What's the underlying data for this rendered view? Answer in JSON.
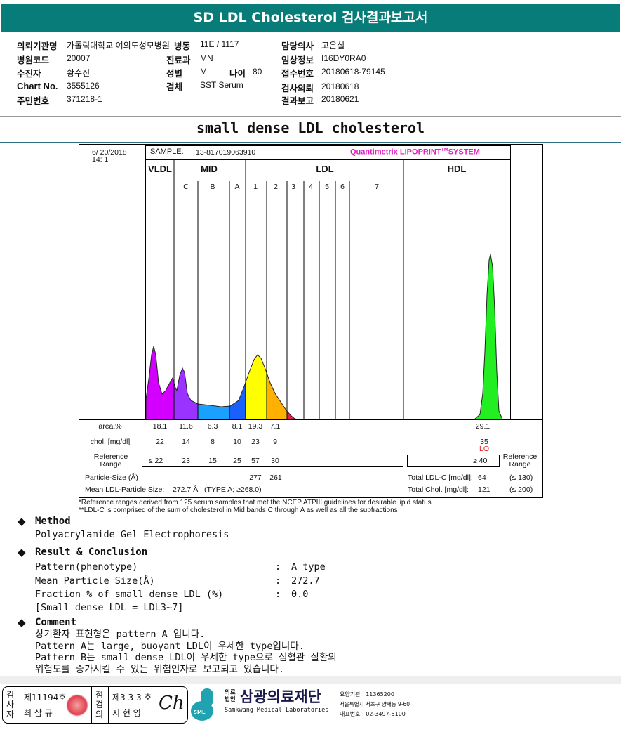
{
  "title": "SD LDL Cholesterol 검사결과보고서",
  "info": {
    "hospital_label": "의뢰기관명",
    "hospital": "가톨릭대학교 여의도성모병원",
    "ward_label": "병동",
    "ward": "11E / 1117",
    "doctor_label": "담당의사",
    "doctor": "고은실",
    "code_label": "병원코드",
    "code": "20007",
    "dept_label": "진료과",
    "dept": "MN",
    "clinical_label": "임상정보",
    "clinical": "I16DY0RA0",
    "patient_label": "수진자",
    "patient": "황수진",
    "sex_label": "성별",
    "sex": "M",
    "age_label": "나이",
    "age": "80",
    "receipt_label": "접수번호",
    "receipt": "20180618-79145",
    "chart_label": "Chart No.",
    "chart": "3555126",
    "specimen_label": "검체",
    "specimen": "SST Serum",
    "request_label": "검사의뢰",
    "request": "20180618",
    "id_label": "주민번호",
    "id": "371218-1",
    "report_label": "결과보고",
    "report": "20180621"
  },
  "subtitle": "small dense LDL cholesterol",
  "lipoprint": {
    "date": "6/ 20/2018",
    "time": "14: 1",
    "sample_label": "SAMPLE:",
    "sample": "13-817019063910",
    "brand": "Quantimetrix LIPOPRINT",
    "brand_tm": "TM",
    "brand_suffix": "SYSTEM",
    "brand_color": "#e020c0",
    "groups": [
      "VLDL",
      "MID",
      "LDL",
      "HDL"
    ],
    "bands": [
      "C",
      "B",
      "A",
      "1",
      "2",
      "3",
      "4",
      "5",
      "6",
      "7"
    ],
    "colors": {
      "vldl": "#d400ff",
      "c": "#9a33ff",
      "b": "#1aa0ff",
      "a": "#1a60ff",
      "ldl1": "#ffff00",
      "ldl2": "#ffb000",
      "ldl3": "#e0204a",
      "hdl": "#22ee22"
    },
    "area_label": "area.%",
    "area": [
      "18.1",
      "11.6",
      "6.3",
      "8.1",
      "19.3",
      "7.1"
    ],
    "hdl_area": "29.1",
    "chol_label": "chol. [mg/dl]",
    "chol": [
      "22",
      "14",
      "8",
      "10",
      "23",
      "9"
    ],
    "hdl_chol": "35",
    "hdl_flag": "LO",
    "ref_label": "Reference Range",
    "ref": [
      "≤ 22",
      "23",
      "15",
      "25",
      "57",
      "30"
    ],
    "hdl_ref": "≥ 40",
    "ref_label_right": "Reference Range",
    "ps_label": "Particle-Size (Å)",
    "ps": [
      "277",
      "261"
    ],
    "mean_label": "Mean LDL-Particle Size:",
    "mean": "272.7 Å",
    "type": "(TYPE A; ≥268.0)",
    "total_ldl_label": "Total LDL-C [mg/dl]:",
    "total_ldl": "64",
    "total_ldl_ref": "(≤ 130)",
    "total_chol_label": "Total Chol. [mg/dl]:",
    "total_chol": "121",
    "total_chol_ref": "(≤ 200)",
    "note1": "*Reference ranges derived from 125 serum samples that met the NCEP ATPIII guidelines for desirable lipid status",
    "note2": "**LDL-C is comprised of the sum of cholesterol in Mid bands C through A as well as all the subfractions"
  },
  "method": {
    "title": "Method",
    "text": "Polyacrylamide Gel Electrophoresis"
  },
  "result": {
    "title": "Result & Conclusion",
    "rows": [
      {
        "label": "Pattern(phenotype)",
        "value": "A type"
      },
      {
        "label": "Mean Particle Size(Å)",
        "value": "272.7"
      },
      {
        "label": "Fraction % of small dense LDL (%)",
        "value": "0.0"
      }
    ],
    "note": "[Small dense LDL = LDL3~7]"
  },
  "comment": {
    "title": "Comment",
    "lines": [
      "상기환자 표현형은 pattern A 입니다.",
      "Pattern A는 large, buoyant LDL이 우세한 type입니다.",
      "Pattern B는 small dense LDL이 우세한 type으로 심혈관 질환의",
      "위험도를 증가시킬 수 있는 위험인자로 보고되고 있습니다."
    ]
  },
  "footer": {
    "tester_label": "검사자",
    "tester_no": "제11194호",
    "tester": "최 삼 규",
    "checker_label": "점검의",
    "checker_no": "제3 3 3 호",
    "checker": "지 현 영",
    "logo_mark": "SML",
    "org_prefix": "의료법인",
    "org": "삼광의료재단",
    "org_en": "Samkwang Medical Laboratories",
    "code": "요양기관 : 11365200",
    "address": "서울특별시 서초구 양재동 9-60",
    "phone": "대표번호 : 02-3497-5100"
  }
}
